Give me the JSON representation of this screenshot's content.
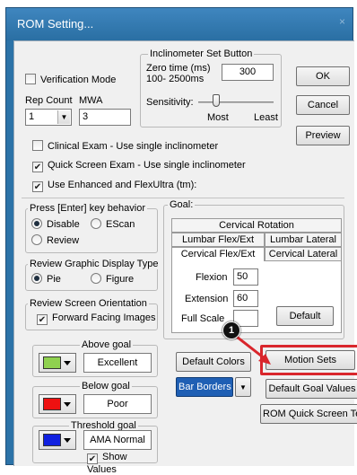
{
  "window": {
    "title": "ROM Setting...",
    "close": "×"
  },
  "verification": {
    "label": "Verification Mode",
    "checked": false
  },
  "inclinometer": {
    "group_label": "Inclinometer Set Button",
    "zero_time_label_1": "Zero time (ms)",
    "zero_time_label_2": "100- 2500ms",
    "zero_time_value": "300",
    "sensitivity_label": "Sensitivity:",
    "most_label": "Most",
    "least_label": "Least"
  },
  "buttons": {
    "ok": "OK",
    "cancel": "Cancel",
    "preview": "Preview",
    "default": "Default",
    "default_colors": "Default Colors",
    "motion_sets": "Motion Sets",
    "default_goal_values": "Default Goal Values",
    "rom_quick_screen_text": "ROM Quick Screen Text",
    "bar_borders": "Bar Borders"
  },
  "rep_count": {
    "label": "Rep Count",
    "value": "1"
  },
  "mwa": {
    "label": "MWA",
    "value": "3"
  },
  "options": {
    "clinical_exam": {
      "label": "Clinical Exam - Use single inclinometer",
      "checked": false
    },
    "quick_screen": {
      "label": "Quick Screen Exam - Use single inclinometer",
      "checked": true
    },
    "enhanced_flexultra": {
      "label": "Use Enhanced and FlexUltra (tm):",
      "checked": true
    }
  },
  "enter_key": {
    "group_label": "Press [Enter] key behavior",
    "disable": "Disable",
    "escan": "EScan",
    "review": "Review"
  },
  "graphic_display": {
    "group_label": "Review Graphic Display Type",
    "pie": "Pie",
    "figure": "Figure"
  },
  "screen_orientation": {
    "group_label": "Review Screen Orientation",
    "forward_facing": "Forward Facing Images"
  },
  "goal": {
    "group_label": "Goal:",
    "tabs": {
      "cervical_rotation": "Cervical Rotation",
      "lumbar_flex_ext": "Lumbar Flex/Ext",
      "lumbar_lateral": "Lumbar Lateral",
      "cervical_flex_ext": "Cervical Flex/Ext",
      "cervical_lateral": "Cervical Lateral"
    },
    "flexion_label": "Flexion",
    "flexion_value": "50",
    "extension_label": "Extension",
    "extension_value": "60",
    "full_scale_label": "Full Scale",
    "full_scale_value": ""
  },
  "above_goal": {
    "label": "Above goal",
    "value": "Excellent",
    "color": "#8fd14f"
  },
  "below_goal": {
    "label": "Below goal",
    "value": "Poor",
    "color": "#ee1111"
  },
  "threshold_goal": {
    "label": "Threshold goal",
    "value": "AMA Normal",
    "color": "#1020e0",
    "show_values": "Show Values"
  },
  "bar_borders_color": "#1f5fb4",
  "callout": {
    "number": "1"
  },
  "highlight_color": "#d9262c"
}
